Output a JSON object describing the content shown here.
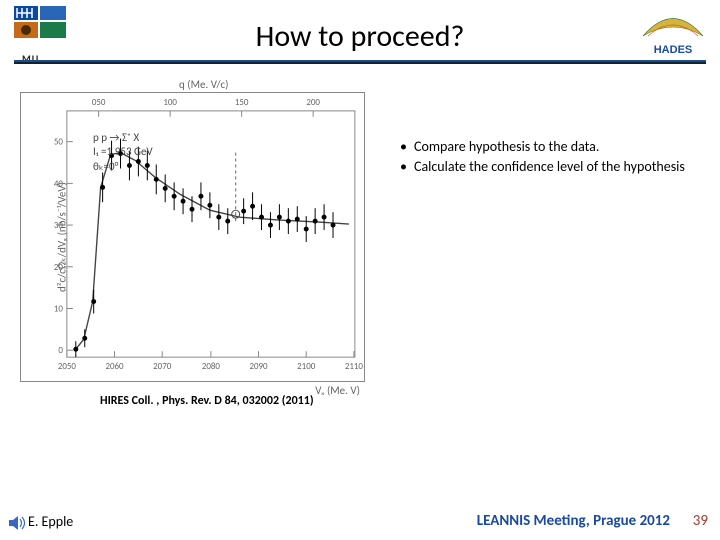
{
  "header": {
    "title": "How to proceed?",
    "mu_label": "MU",
    "hades_label": "HADES"
  },
  "chart": {
    "citation": "HIRES Coll. , Phys. Rev. D 84, 032002 (2011)",
    "x_label_top": "q  (Me. V/c)",
    "x_label_bottom": "Vₓ  (Me. V)",
    "y_label": "d²c/cΩₖ/dVₓ  (nb/s⁻¹/VeV)",
    "inset": {
      "reaction": "p p  →  Σ⁺ X",
      "energy": "I₁ =1.953  GeV",
      "angle": "θₖ=0°"
    },
    "x_ticks_top": [
      "050",
      "100",
      "150",
      "200"
    ],
    "x_ticks_bottom": [
      "2050",
      "2060",
      "2070",
      "2080",
      "2090",
      "2100",
      "2110"
    ],
    "y_ticks": [
      "0",
      "10",
      "20",
      "30",
      "40",
      "50"
    ]
  },
  "bullets": [
    "Compare hypothesis to the data.",
    "Calculate the confidence level of the hypothesis"
  ],
  "footer": {
    "author": "E. Epple",
    "meeting": "LEANNIS Meeting, Prague 2012",
    "page": "39"
  },
  "chart_data": {
    "type": "scatter",
    "title": "",
    "xlabel": "Vₓ (MeV)",
    "ylabel": "d²σ/dΩₖ/dVₓ (nb/sr/MeV)",
    "xlim": [
      2050,
      2115
    ],
    "ylim": [
      -2,
      55
    ],
    "x": [
      2052,
      2054,
      2056,
      2058,
      2060,
      2062,
      2064,
      2066,
      2068,
      2070,
      2072,
      2074,
      2076,
      2078,
      2080,
      2082,
      2084,
      2086,
      2088,
      2090,
      2092,
      2094,
      2096,
      2098,
      2100,
      2102,
      2104,
      2106,
      2108,
      2110
    ],
    "y": [
      0,
      3,
      12,
      38,
      46,
      47,
      43,
      45,
      44,
      40,
      38,
      36,
      35,
      33,
      37,
      34,
      31,
      30,
      29,
      31,
      33,
      30,
      28,
      30,
      29,
      30,
      27,
      29,
      30,
      28
    ],
    "y_err": [
      2,
      3,
      4,
      6,
      6,
      6,
      6,
      6,
      6,
      6,
      6,
      5,
      5,
      5,
      6,
      5,
      5,
      5,
      5,
      5,
      6,
      5,
      5,
      5,
      5,
      5,
      5,
      5,
      5,
      5
    ],
    "series": [
      {
        "name": "data points with error bars",
        "style": "filled circle"
      }
    ],
    "annotations": [
      {
        "x": 2086,
        "y": 35,
        "style": "open circle marker on curve (peak search)"
      }
    ]
  }
}
